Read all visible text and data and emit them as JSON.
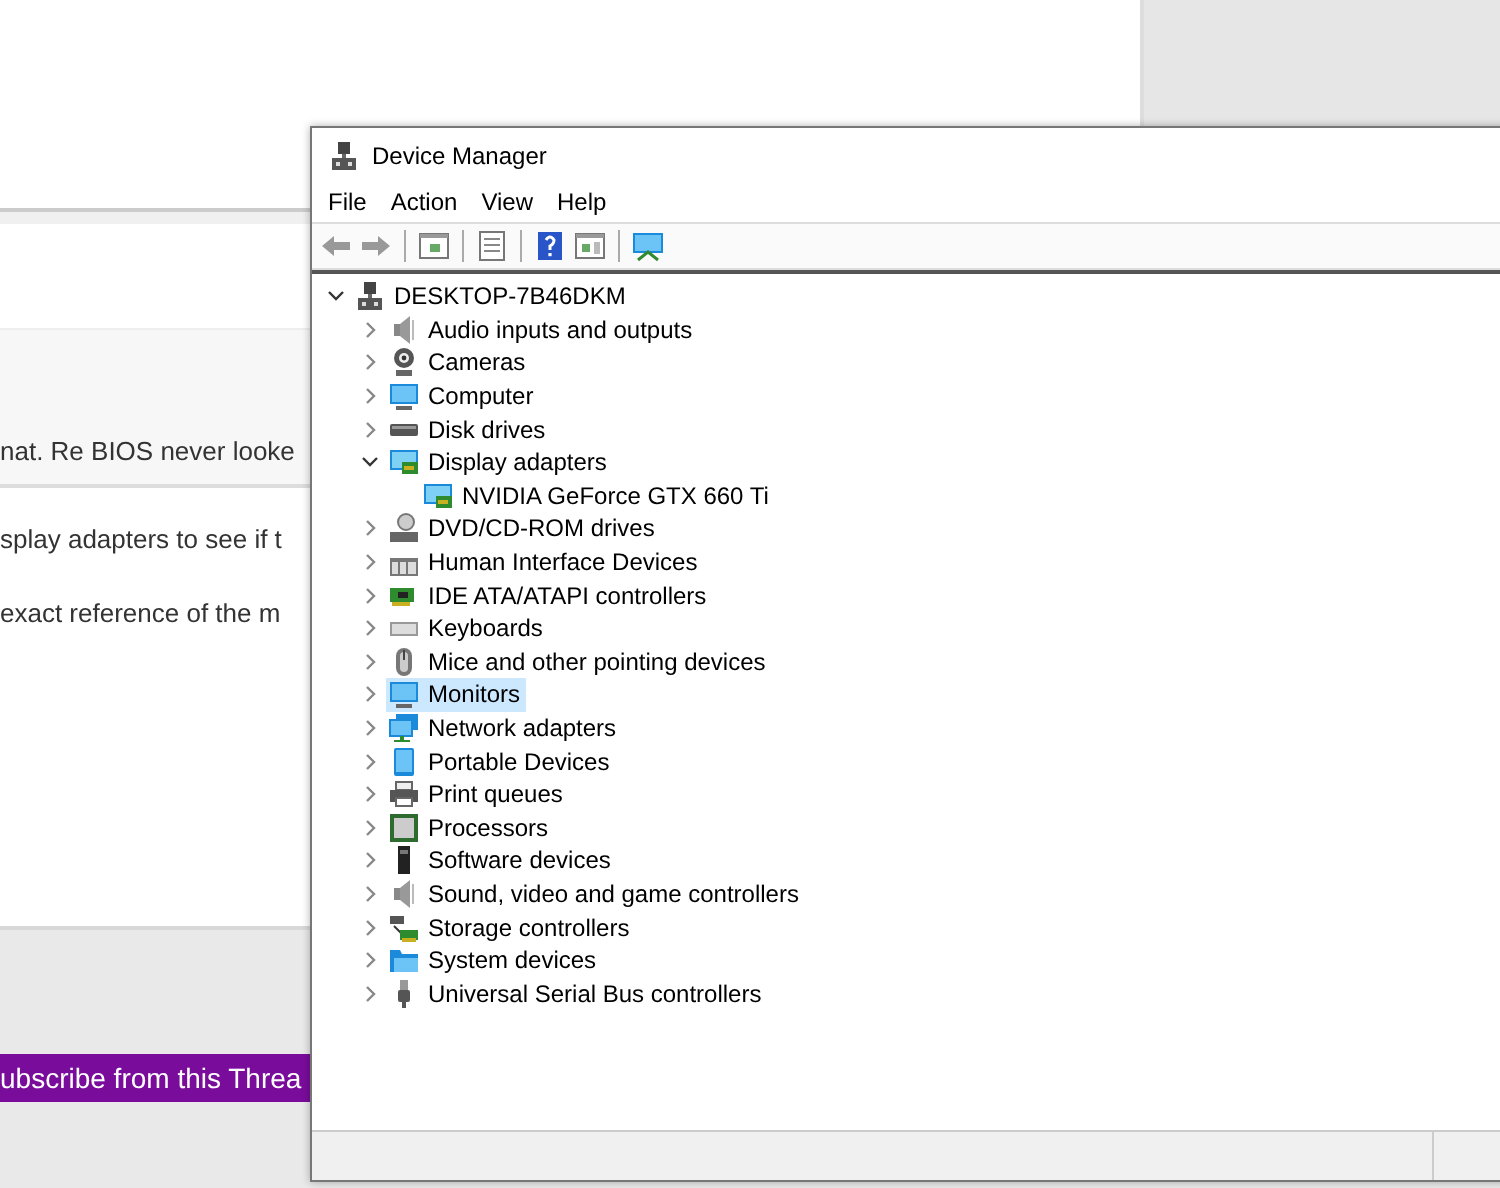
{
  "background_page": {
    "quote_text": "nat. Re BIOS never looke",
    "paragraphs": [
      "splay adapters to see if t",
      "exact reference of the m"
    ],
    "subscribe_button": "ubscribe from this Threa"
  },
  "window": {
    "title": "Device Manager",
    "menu": [
      "File",
      "Action",
      "View",
      "Help"
    ],
    "tree": [
      {
        "label": "DESKTOP-7B46DKM",
        "kind": "computer",
        "expanded": true,
        "selected": false,
        "children": [
          {
            "label": "Audio inputs and outputs",
            "kind": "speaker",
            "expanded": false,
            "selected": false
          },
          {
            "label": "Cameras",
            "kind": "camera",
            "expanded": false,
            "selected": false
          },
          {
            "label": "Computer",
            "kind": "monitor",
            "expanded": false,
            "selected": false
          },
          {
            "label": "Disk drives",
            "kind": "disk",
            "expanded": false,
            "selected": false
          },
          {
            "label": "Display adapters",
            "kind": "adapter",
            "expanded": true,
            "selected": false,
            "children": [
              {
                "label": "NVIDIA GeForce GTX 660 Ti",
                "kind": "adapter",
                "selected": false
              }
            ]
          },
          {
            "label": "DVD/CD-ROM drives",
            "kind": "dvd",
            "expanded": false,
            "selected": false
          },
          {
            "label": "Human Interface Devices",
            "kind": "hid",
            "expanded": false,
            "selected": false
          },
          {
            "label": "IDE ATA/ATAPI controllers",
            "kind": "card",
            "expanded": false,
            "selected": false
          },
          {
            "label": "Keyboards",
            "kind": "keyboard",
            "expanded": false,
            "selected": false
          },
          {
            "label": "Mice and other pointing devices",
            "kind": "mouse",
            "expanded": false,
            "selected": false
          },
          {
            "label": "Monitors",
            "kind": "monitor",
            "expanded": false,
            "selected": true
          },
          {
            "label": "Network adapters",
            "kind": "network",
            "expanded": false,
            "selected": false
          },
          {
            "label": "Portable Devices",
            "kind": "portable",
            "expanded": false,
            "selected": false
          },
          {
            "label": "Print queues",
            "kind": "printer",
            "expanded": false,
            "selected": false
          },
          {
            "label": "Processors",
            "kind": "chip",
            "expanded": false,
            "selected": false
          },
          {
            "label": "Software devices",
            "kind": "software",
            "expanded": false,
            "selected": false
          },
          {
            "label": "Sound, video and game controllers",
            "kind": "speaker",
            "expanded": false,
            "selected": false
          },
          {
            "label": "Storage controllers",
            "kind": "storage",
            "expanded": false,
            "selected": false
          },
          {
            "label": "System devices",
            "kind": "folder",
            "expanded": false,
            "selected": false
          },
          {
            "label": "Universal Serial Bus controllers",
            "kind": "usb",
            "expanded": false,
            "selected": false
          }
        ]
      }
    ]
  }
}
